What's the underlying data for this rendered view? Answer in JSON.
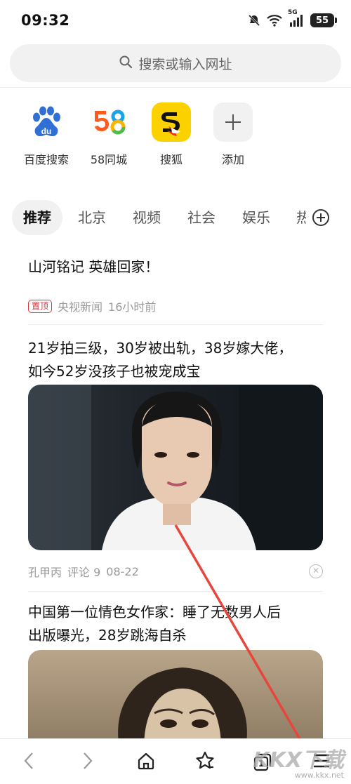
{
  "status_bar": {
    "time": "09:32",
    "network": "5G",
    "battery": "55"
  },
  "search": {
    "placeholder": "搜索或输入网址",
    "icon": "search-icon"
  },
  "shortcuts": [
    {
      "label": "百度搜索",
      "icon": "baidu-logo-icon"
    },
    {
      "label": "58同城",
      "icon": "58-logo-icon"
    },
    {
      "label": "搜狐",
      "icon": "sohu-logo-icon"
    },
    {
      "label": "添加",
      "icon": "plus-icon"
    }
  ],
  "tabs": [
    {
      "label": "推荐",
      "active": true
    },
    {
      "label": "北京"
    },
    {
      "label": "视频"
    },
    {
      "label": "社会"
    },
    {
      "label": "娱乐"
    },
    {
      "label": "热"
    }
  ],
  "feed": [
    {
      "title": "山河铭记 英雄回家！",
      "badge": "置顶",
      "source": "央视新闻",
      "time": "16小时前"
    },
    {
      "title_line1": "21岁拍三级，30岁被出轨，38岁嫁大佬，",
      "title_line2": "如今52岁没孩子也被宠成宝",
      "source": "孔甲丙",
      "comments": "评论 9",
      "date": "08-22"
    },
    {
      "title_line1": "中国第一位情色女作家：睡了无数男人后",
      "title_line2": "出版曝光，28岁跳海自杀"
    }
  ],
  "bottom_nav": {
    "items": [
      "back-icon",
      "forward-icon",
      "home-icon",
      "bookmark-star-icon",
      "tabs-icon",
      "menu-icon"
    ],
    "tab_count": "1"
  },
  "watermark": {
    "logo": "KKX下载",
    "url": "www.kkx.net"
  },
  "colors": {
    "accent_red": "#d9363e",
    "arrow": "#e8453c"
  }
}
